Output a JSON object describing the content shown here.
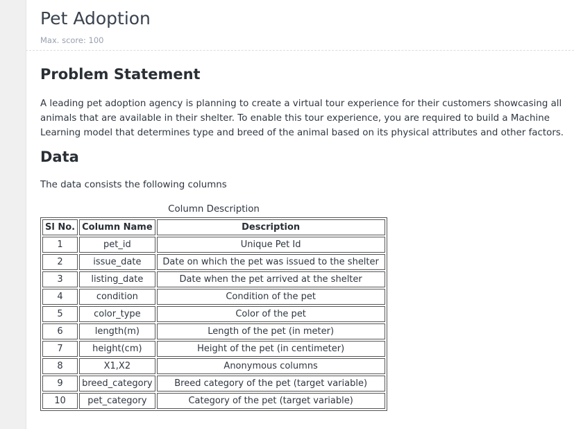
{
  "page": {
    "title": "Pet Adoption",
    "max_score": "Max. score: 100"
  },
  "problem": {
    "heading": "Problem Statement",
    "text": "A leading pet adoption agency is planning to create a virtual tour experience for their customers showcasing all animals that are available in their shelter. To enable this tour experience, you are required to build a Machine Learning model that determines type and breed of the animal based on its physical attributes and other factors."
  },
  "data_section": {
    "heading": "Data",
    "intro": "The data consists the following columns",
    "table": {
      "caption": "Column Description",
      "headers": [
        "Sl No.",
        "Column Name",
        "Description"
      ],
      "rows": [
        [
          "1",
          "pet_id",
          "Unique Pet Id"
        ],
        [
          "2",
          "issue_date",
          "Date on which the pet was issued to the shelter"
        ],
        [
          "3",
          "listing_date",
          "Date when the pet arrived at the shelter"
        ],
        [
          "4",
          "condition",
          "Condition of the pet"
        ],
        [
          "5",
          "color_type",
          "Color of the pet"
        ],
        [
          "6",
          "length(m)",
          "Length of the pet (in meter)"
        ],
        [
          "7",
          "height(cm)",
          "Height of the pet (in centimeter)"
        ],
        [
          "8",
          "X1,X2",
          "Anonymous columns"
        ],
        [
          "9",
          "breed_category",
          "Breed category of the pet (target variable)"
        ],
        [
          "10",
          "pet_category",
          "Category of the pet (target variable)"
        ]
      ]
    }
  }
}
